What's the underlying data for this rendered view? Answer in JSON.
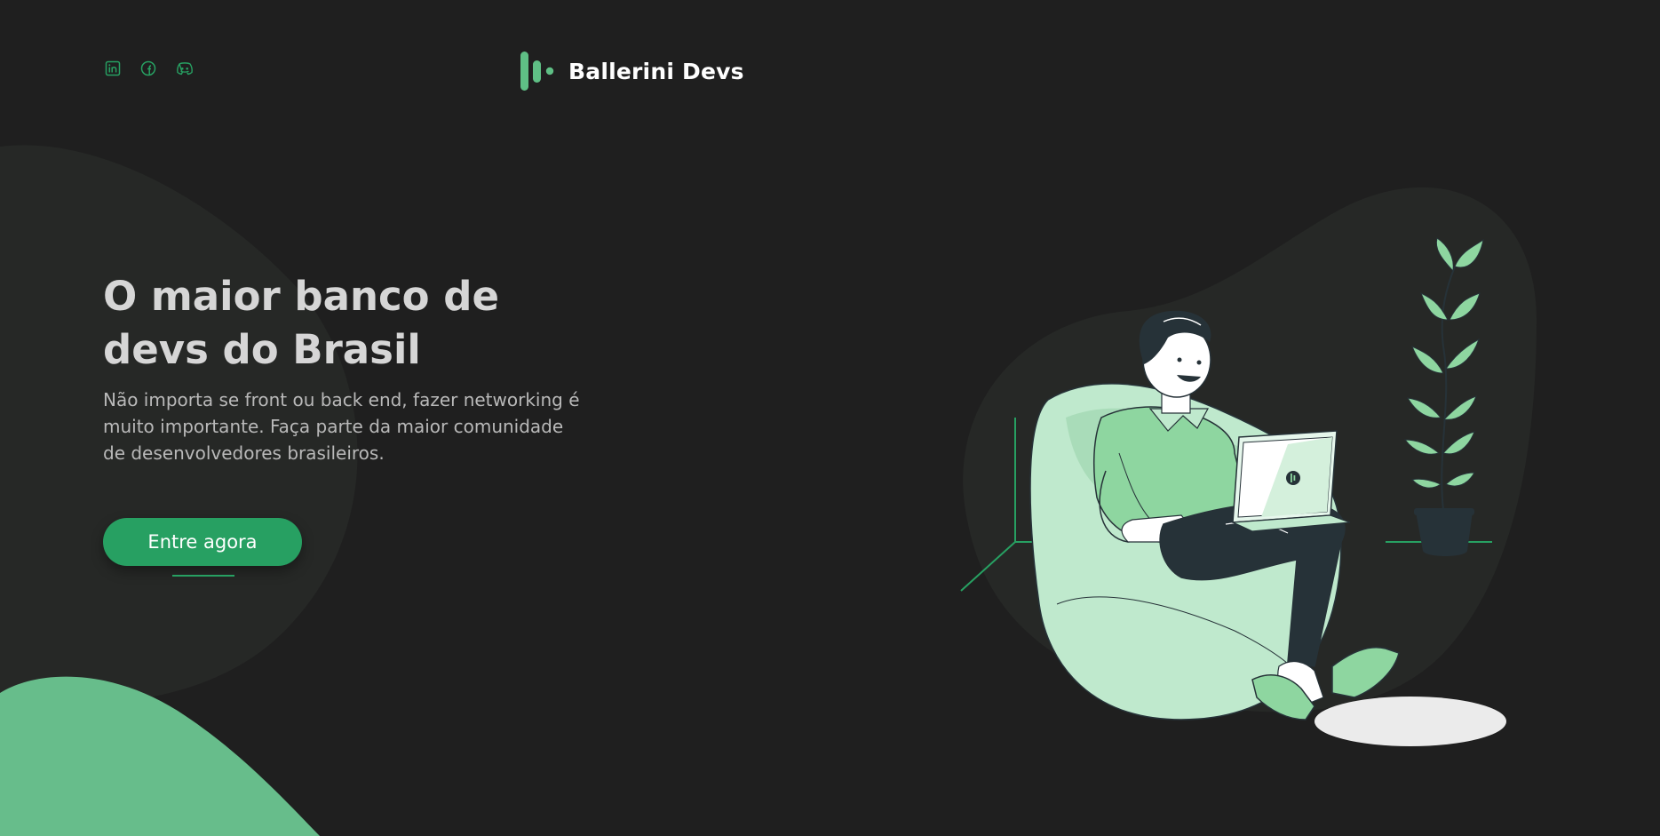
{
  "brand": {
    "name": "Ballerini Devs",
    "accent": "#27a062",
    "logo_color": "#5fbf85"
  },
  "social": [
    {
      "name": "linkedin-icon"
    },
    {
      "name": "facebook-icon"
    },
    {
      "name": "discord-icon"
    }
  ],
  "hero": {
    "title": "O maior banco de devs do Brasil",
    "description": "Não importa se front ou back end, fazer networking é muito importante. Faça parte da maior comunidade de desenvolvedores brasileiros.",
    "cta_label": "Entre agora"
  },
  "colors": {
    "background": "#1f1f1f",
    "blob_dark": "#262826",
    "blob_green": "#67bd8b",
    "light_green": "#bfe9cd",
    "mid_green": "#8ed6a0"
  },
  "illustration": {
    "name": "developer-on-beanbag-illustration"
  }
}
